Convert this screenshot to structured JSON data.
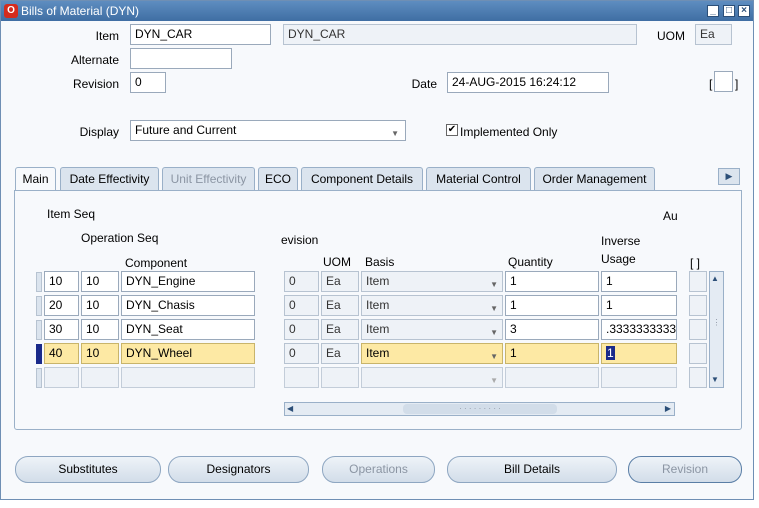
{
  "window": {
    "title": "Bills of Material (DYN)",
    "logo": "O",
    "controls": [
      "minimize",
      "maximize",
      "close"
    ]
  },
  "header": {
    "item_label": "Item",
    "item_value": "DYN_CAR",
    "item_desc": "DYN_CAR",
    "uom_label": "UOM",
    "uom_value": "Ea",
    "alternate_label": "Alternate",
    "alternate_value": "",
    "revision_label": "Revision",
    "revision_value": "0",
    "date_label": "Date",
    "date_value": "24-AUG-2015 16:24:12",
    "bracket_text": "[",
    "bracket_close": "]",
    "display_label": "Display",
    "display_value": "Future and Current",
    "implemented_only_label": "Implemented Only",
    "implemented_only_checked": true
  },
  "tabs": [
    {
      "label": "Main",
      "state": "active"
    },
    {
      "label": "Date Effectivity",
      "state": "normal"
    },
    {
      "label": "Unit Effectivity",
      "state": "disabled"
    },
    {
      "label": "ECO",
      "state": "normal"
    },
    {
      "label": "Component Details",
      "state": "normal"
    },
    {
      "label": "Material Control",
      "state": "normal"
    },
    {
      "label": "Order Management",
      "state": "normal"
    }
  ],
  "grid": {
    "headers": {
      "item_seq": "Item Seq",
      "operation_seq": "Operation Seq",
      "component": "Component",
      "revision": "evision",
      "uom": "UOM",
      "basis": "Basis",
      "quantity": "Quantity",
      "inverse_usage_1": "Inverse",
      "inverse_usage_2": "Usage",
      "au": "Au",
      "bracket": "[ ]"
    },
    "rows": [
      {
        "item_seq": "10",
        "op_seq": "10",
        "component": "DYN_Engine",
        "revision": "0",
        "uom": "Ea",
        "basis": "Item",
        "quantity": "1",
        "inverse": "1",
        "current": false
      },
      {
        "item_seq": "20",
        "op_seq": "10",
        "component": "DYN_Chasis",
        "revision": "0",
        "uom": "Ea",
        "basis": "Item",
        "quantity": "1",
        "inverse": "1",
        "current": false
      },
      {
        "item_seq": "30",
        "op_seq": "10",
        "component": "DYN_Seat",
        "revision": "0",
        "uom": "Ea",
        "basis": "Item",
        "quantity": "3",
        "inverse": ".3333333333",
        "current": false
      },
      {
        "item_seq": "40",
        "op_seq": "10",
        "component": "DYN_Wheel",
        "revision": "0",
        "uom": "Ea",
        "basis": "Item",
        "quantity": "1",
        "inverse": "1",
        "current": true
      }
    ]
  },
  "buttons": [
    {
      "label": "Substitutes",
      "accel": "b",
      "enabled": true
    },
    {
      "label": "Designators",
      "accel": "D",
      "enabled": true
    },
    {
      "label": "Operations",
      "accel": "O",
      "enabled": false
    },
    {
      "label": "Bill Details",
      "accel": "D",
      "enabled": true
    },
    {
      "label": "Revision",
      "accel": "R",
      "enabled": false
    }
  ],
  "colors": {
    "titlebar": "#3f6ea3",
    "highlight_row": "#fde9a4",
    "current_record": "#1a2a8a",
    "logo_red": "#d52b1e"
  }
}
